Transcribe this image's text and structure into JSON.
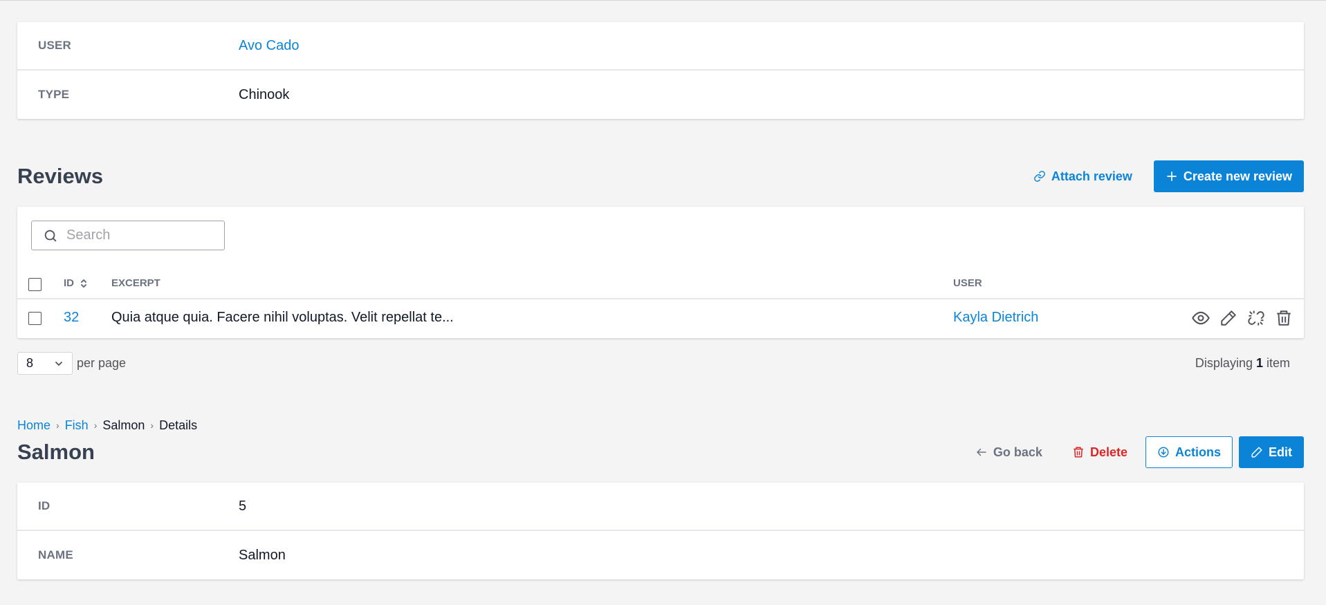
{
  "top_panel": {
    "rows": [
      {
        "label": "USER",
        "value": "Avo Cado",
        "is_link": true
      },
      {
        "label": "TYPE",
        "value": "Chinook",
        "is_link": false
      }
    ]
  },
  "reviews": {
    "title": "Reviews",
    "attach_label": "Attach review",
    "create_label": "Create new review",
    "search": {
      "placeholder": "Search",
      "value": ""
    },
    "columns": {
      "id": "ID",
      "excerpt": "EXCERPT",
      "user": "USER"
    },
    "rows": [
      {
        "id": "32",
        "excerpt": "Quia atque quia. Facere nihil voluptas. Velit repellat te...",
        "user": "Kayla Dietrich"
      }
    ],
    "row_actions": [
      "eye-icon",
      "pencil-icon",
      "unlink-icon",
      "trash-icon"
    ],
    "per_page": {
      "value": "8",
      "label": "per page"
    },
    "display": {
      "prefix": "Displaying",
      "count": "1",
      "suffix": "item"
    }
  },
  "detail": {
    "breadcrumbs": [
      {
        "label": "Home",
        "is_link": true
      },
      {
        "label": "Fish",
        "is_link": true
      },
      {
        "label": "Salmon",
        "is_link": false
      },
      {
        "label": "Details",
        "is_link": false
      }
    ],
    "title": "Salmon",
    "go_back_label": "Go back",
    "delete_label": "Delete",
    "actions_label": "Actions",
    "edit_label": "Edit",
    "rows": [
      {
        "label": "ID",
        "value": "5"
      },
      {
        "label": "NAME",
        "value": "Salmon"
      }
    ]
  },
  "colors": {
    "accent": "#0b84d8",
    "danger": "#dc2626",
    "background": "#f4f4f5"
  }
}
